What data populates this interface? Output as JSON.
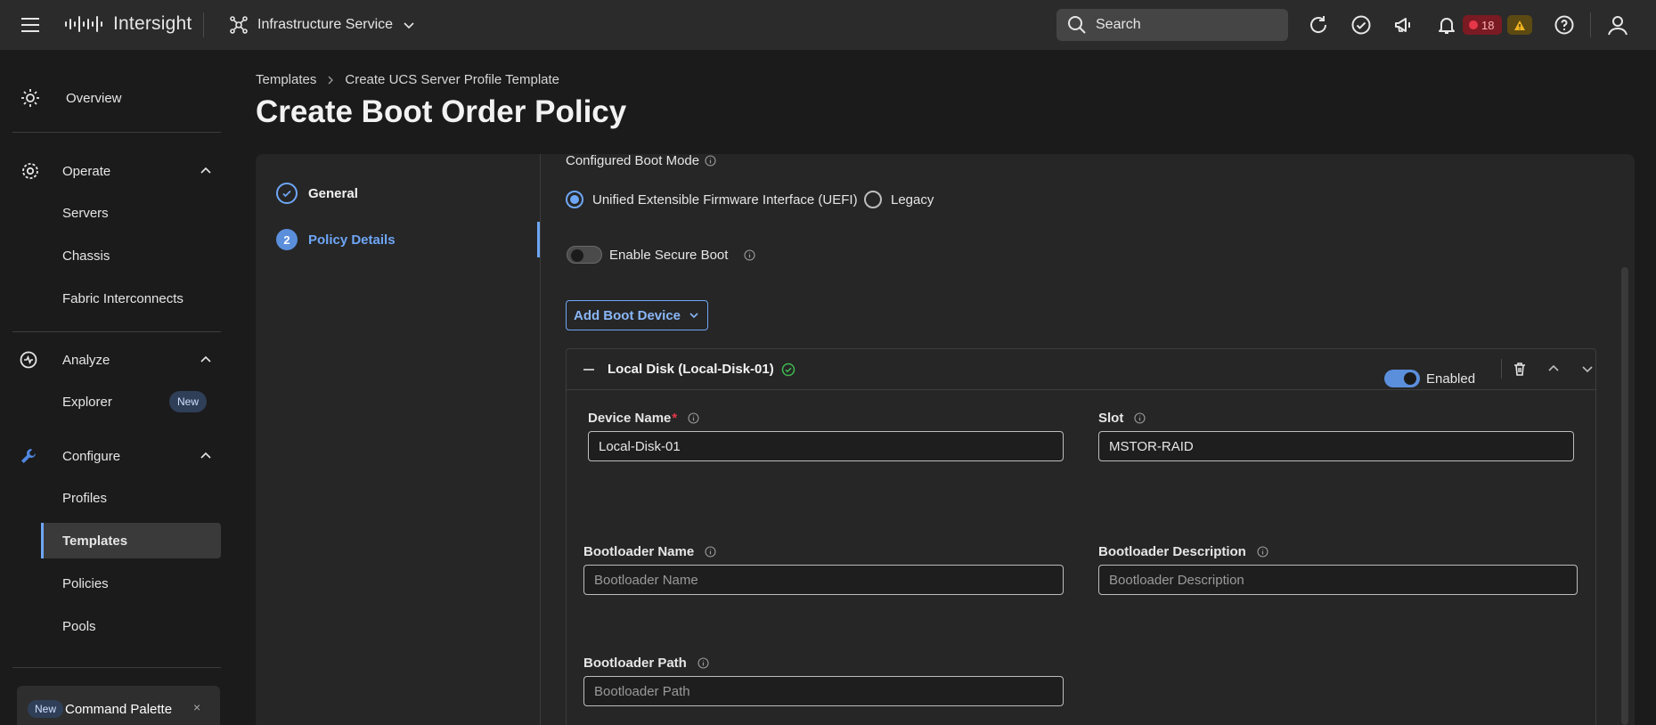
{
  "header": {
    "app_name": "Intersight",
    "service": "Infrastructure Service",
    "search_label": "Search",
    "alarm_count": "18",
    "colors": {
      "accent": "#6ea6f6",
      "critical": "#e5364a",
      "warning": "#f0b322"
    }
  },
  "sidebar": {
    "overview": "Overview",
    "operate": {
      "label": "Operate",
      "items": [
        "Servers",
        "Chassis",
        "Fabric Interconnects"
      ]
    },
    "analyze": {
      "label": "Analyze",
      "items": [
        "Explorer"
      ],
      "new_badge": "New"
    },
    "configure": {
      "label": "Configure",
      "items": [
        "Profiles",
        "Templates",
        "Policies",
        "Pools"
      ],
      "active": "Templates"
    },
    "command_palette": {
      "badge": "New",
      "label": "Command Palette",
      "close": "×"
    }
  },
  "breadcrumb": [
    "Templates",
    "Create UCS Server Profile Template"
  ],
  "page_title": "Create Boot Order Policy",
  "steps": [
    {
      "number": "1",
      "label": "General",
      "state": "done"
    },
    {
      "number": "2",
      "label": "Policy Details",
      "state": "active"
    }
  ],
  "form": {
    "boot_mode_label": "Configured Boot Mode",
    "boot_mode_options": [
      "Unified Extensible Firmware Interface (UEFI)",
      "Legacy"
    ],
    "boot_mode_selected": "Unified Extensible Firmware Interface (UEFI)",
    "secure_boot_label": "Enable Secure Boot",
    "secure_boot_enabled": false,
    "add_boot_device": "Add Boot Device",
    "device": {
      "title": "Local Disk (Local-Disk-01)",
      "enabled_label": "Enabled",
      "enabled": true,
      "device_name_label": "Device Name",
      "required_mark": "*",
      "device_name_value": "Local-Disk-01",
      "slot_label": "Slot",
      "slot_value": "MSTOR-RAID",
      "bootloader_name_label": "Bootloader Name",
      "bootloader_name_placeholder": "Bootloader Name",
      "bootloader_desc_label": "Bootloader Description",
      "bootloader_desc_placeholder": "Bootloader Description",
      "bootloader_path_label": "Bootloader Path",
      "bootloader_path_placeholder": "Bootloader Path"
    }
  }
}
